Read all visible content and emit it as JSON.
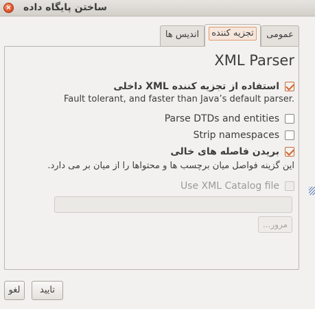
{
  "window": {
    "title": "ساختن پایگاه داده",
    "close_glyph": "×"
  },
  "tabs": [
    {
      "label": "عمومی",
      "active": false
    },
    {
      "label": "تجزیه کننده",
      "active": true
    },
    {
      "label": "اندیس ها",
      "active": false
    }
  ],
  "parser": {
    "title": "XML Parser",
    "options": [
      {
        "label": "استفاده از تجزیه کننده XML داخلی",
        "checked": true,
        "enabled": true,
        "description": "Fault tolerant, and faster than Java’s default parser."
      },
      {
        "label": "Parse DTDs and entities",
        "checked": false,
        "enabled": true
      },
      {
        "label": "Strip namespaces",
        "checked": false,
        "enabled": true
      },
      {
        "label": "بریدن فاصله های خالی",
        "checked": true,
        "enabled": true,
        "description": "این گزینه فواصل میان برچسب ها و محتواها را از میان بر می دارد."
      },
      {
        "label": "Use XML Catalog file",
        "checked": false,
        "enabled": false
      }
    ],
    "catalog_path_value": "",
    "browse_label": "مرور..."
  },
  "footer": {
    "ok_label": "تایید",
    "cancel_label": "لغو"
  },
  "colors": {
    "accent": "#d2632a",
    "background": "#f2f1f0"
  }
}
